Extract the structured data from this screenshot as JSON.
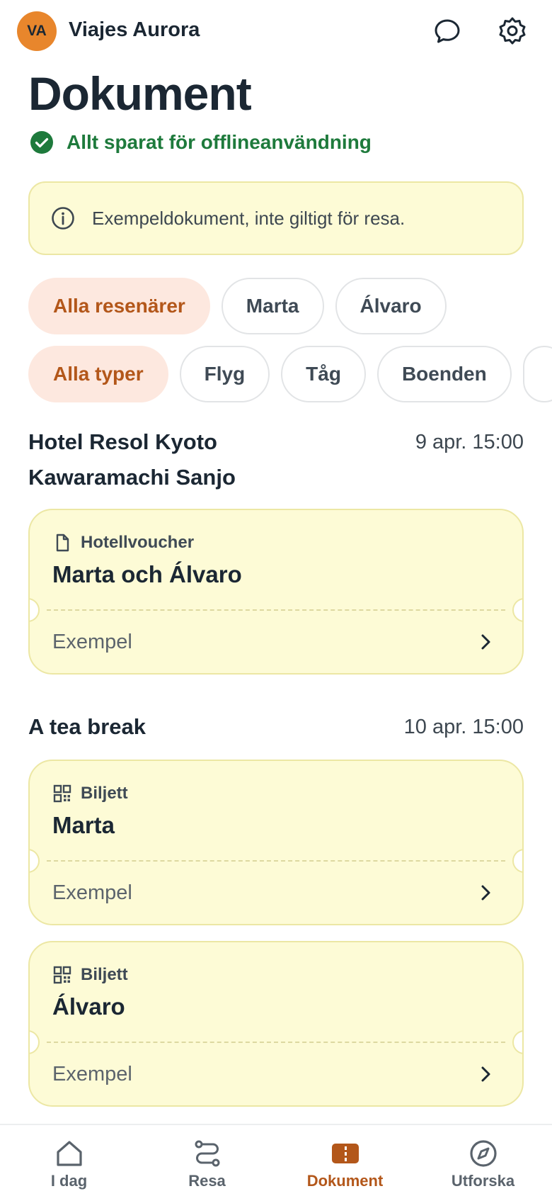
{
  "header": {
    "avatar_initials": "VA",
    "agency_name": "Viajes Aurora",
    "icons": [
      "chat-icon",
      "gear-icon"
    ]
  },
  "page": {
    "title": "Dokument",
    "saved_status": "Allt sparat för offlineanvändning"
  },
  "info_banner": {
    "text": "Exempeldokument, inte giltigt för resa."
  },
  "filters": {
    "travelers": [
      "Alla resenärer",
      "Marta",
      "Álvaro"
    ],
    "types": [
      "Alla typer",
      "Flyg",
      "Tåg",
      "Boenden"
    ],
    "active_traveler": "Alla resenärer",
    "active_type": "Alla typer"
  },
  "sections": [
    {
      "title_line1": "Hotel Resol Kyoto",
      "title_line2": "Kawaramachi Sanjo",
      "date": "9 apr. 15:00",
      "documents": [
        {
          "type_label": "Hotellvoucher",
          "icon": "document-icon",
          "name": "Marta och Álvaro",
          "footer": "Exempel"
        }
      ]
    },
    {
      "title_line1": "A tea break",
      "date": "10 apr. 15:00",
      "documents": [
        {
          "type_label": "Biljett",
          "icon": "qr-code-icon",
          "name": "Marta",
          "footer": "Exempel"
        },
        {
          "type_label": "Biljett",
          "icon": "qr-code-icon",
          "name": "Álvaro",
          "footer": "Exempel"
        }
      ]
    }
  ],
  "bottom_nav": {
    "items": [
      {
        "label": "I dag",
        "icon": "home-icon"
      },
      {
        "label": "Resa",
        "icon": "route-icon"
      },
      {
        "label": "Dokument",
        "icon": "ticket-icon"
      },
      {
        "label": "Utforska",
        "icon": "compass-icon"
      }
    ],
    "active": "Dokument"
  },
  "colors": {
    "accent": "#b3571a",
    "avatar": "#e8862c",
    "success": "#1e7a3c",
    "card_bg": "#fdfbd6",
    "chip_active_bg": "#fde8df",
    "text": "#1b2733"
  }
}
